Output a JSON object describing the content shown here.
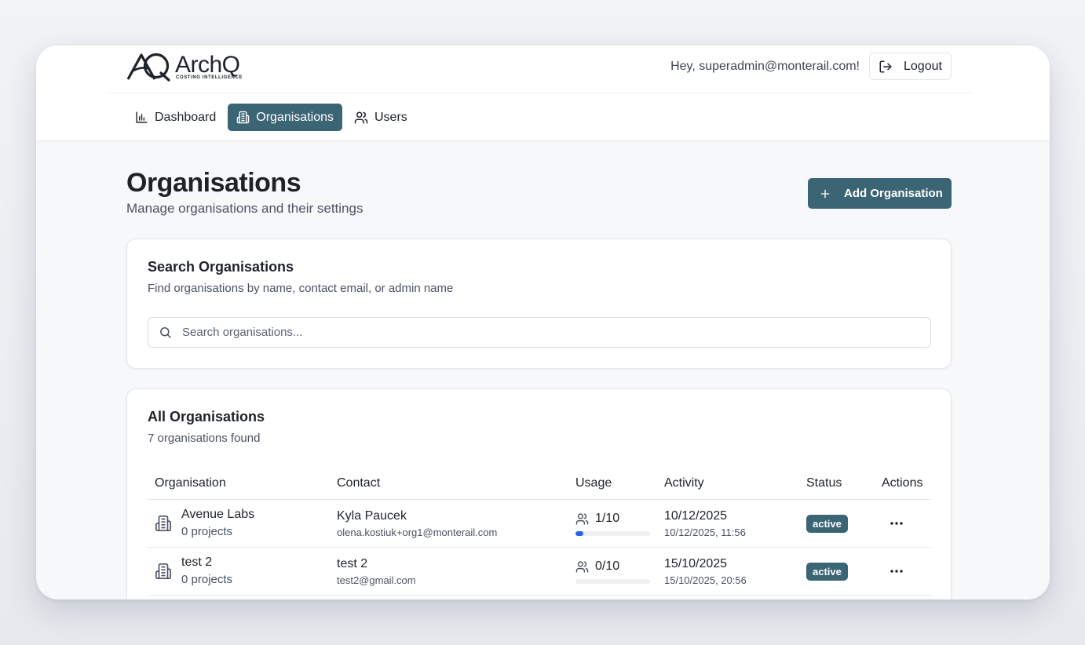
{
  "brand": {
    "name": "ArchQ",
    "tagline": "COSTING INTELLIGENCE"
  },
  "header": {
    "greeting": "Hey, superadmin@monterail.com!",
    "logout_label": "Logout"
  },
  "nav": {
    "items": [
      {
        "label": "Dashboard",
        "icon": "bar-chart-icon",
        "active": false
      },
      {
        "label": "Organisations",
        "icon": "building-icon",
        "active": true
      },
      {
        "label": "Users",
        "icon": "users-icon",
        "active": false
      }
    ]
  },
  "page": {
    "title": "Organisations",
    "subtitle": "Manage organisations and their settings",
    "add_button_label": "Add Organisation"
  },
  "search": {
    "title": "Search Organisations",
    "subtitle": "Find organisations by name, contact email, or admin name",
    "placeholder": "Search organisations...",
    "value": ""
  },
  "list": {
    "title": "All Organisations",
    "count_text": "7 organisations found",
    "columns": [
      "Organisation",
      "Contact",
      "Usage",
      "Activity",
      "Status",
      "Actions"
    ],
    "rows": [
      {
        "name": "Avenue Labs",
        "projects": "0 projects",
        "contact_name": "Kyla Paucek",
        "contact_email": "olena.kostiuk+org1@monterail.com",
        "usage_text": "1/10",
        "usage_fraction": 0.1,
        "activity_date": "10/12/2025",
        "activity_time": "10/12/2025, 11:56",
        "status": "active"
      },
      {
        "name": "test 2",
        "projects": "0 projects",
        "contact_name": "test 2",
        "contact_email": "test2@gmail.com",
        "usage_text": "0/10",
        "usage_fraction": 0,
        "activity_date": "15/10/2025",
        "activity_time": "15/10/2025, 20:56",
        "status": "active"
      }
    ]
  },
  "colors": {
    "accent": "#3b6474",
    "usage_bar": "#2563eb"
  }
}
